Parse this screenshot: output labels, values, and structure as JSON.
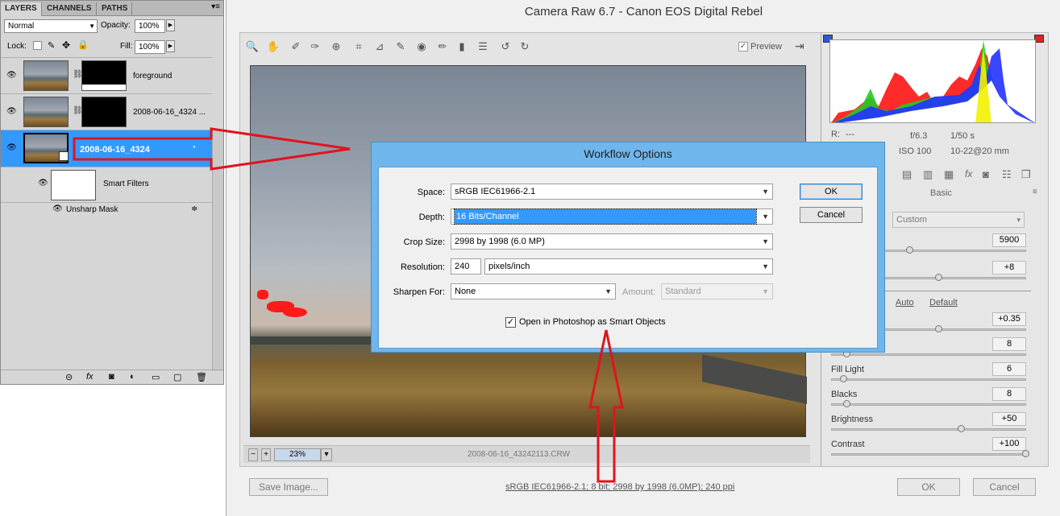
{
  "layers_panel": {
    "tabs": [
      "LAYERS",
      "CHANNELS",
      "PATHS"
    ],
    "blend_mode": "Normal",
    "opacity_label": "Opacity:",
    "opacity_value": "100%",
    "lock_label": "Lock:",
    "fill_label": "Fill:",
    "fill_value": "100%",
    "layers": [
      {
        "name": "foreground"
      },
      {
        "name": "2008-06-16_4324 ..."
      },
      {
        "name": "2008-06-16_4324"
      }
    ],
    "smart_filters_label": "Smart Filters",
    "filter_name": "Unsharp Mask"
  },
  "camera_raw": {
    "title": "Camera Raw 6.7  -  Canon EOS Digital Rebel",
    "preview_label": "Preview",
    "zoom_value": "23%",
    "filename": "2008-06-16_43242113.CRW",
    "workflow_link": "sRGB IEC61966-2.1; 8 bit; 2998 by 1998 (6.0MP); 240 ppi",
    "save_image_button": "Save Image...",
    "ok_button": "OK",
    "cancel_button": "Cancel",
    "exif": {
      "r_label": "R:",
      "r_value": "---",
      "aperture": "f/6.3",
      "shutter": "1/50 s",
      "iso": "ISO 100",
      "lens": "10-22@20 mm"
    },
    "panel_title": "Basic",
    "wb_value": "Custom",
    "temp_value": "5900",
    "tint_value": "+8",
    "auto_link": "Auto",
    "default_link": "Default",
    "exposure_value": "+0.35",
    "recovery_value": "8",
    "adjustments": [
      {
        "label": "Fill Light",
        "value": "6"
      },
      {
        "label": "Blacks",
        "value": "8"
      },
      {
        "label": "Brightness",
        "value": "+50"
      },
      {
        "label": "Contrast",
        "value": "+100"
      }
    ]
  },
  "workflow_dialog": {
    "title": "Workflow Options",
    "space_label": "Space:",
    "space_value": "sRGB IEC61966-2.1",
    "depth_label": "Depth:",
    "depth_value": "16 Bits/Channel",
    "crop_label": "Crop Size:",
    "crop_value": "2998 by 1998  (6.0 MP)",
    "resolution_label": "Resolution:",
    "resolution_value": "240",
    "resolution_unit": "pixels/inch",
    "sharpen_label": "Sharpen For:",
    "sharpen_value": "None",
    "amount_label": "Amount:",
    "amount_value": "Standard",
    "smart_objects_label": "Open in Photoshop as Smart Objects",
    "ok_button": "OK",
    "cancel_button": "Cancel"
  },
  "colors": {
    "annotation_red": "#e0141e",
    "selection_blue": "#3399ff",
    "dialog_frame": "#6fb6ec"
  }
}
